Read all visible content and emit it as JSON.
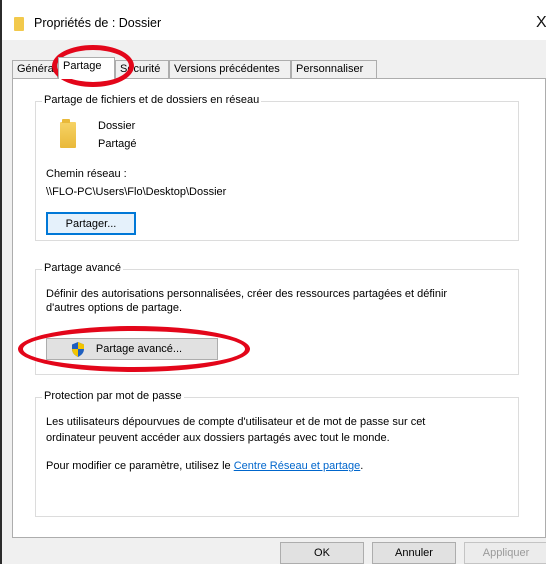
{
  "window": {
    "title": "Propriétés de : Dossier",
    "close_symbol": "X"
  },
  "tabs": [
    {
      "label": "Général",
      "active": false
    },
    {
      "label": "Partage",
      "active": true
    },
    {
      "label": "Sécurité",
      "active": false
    },
    {
      "label": "Versions précédentes",
      "active": false
    },
    {
      "label": "Personnaliser",
      "active": false
    }
  ],
  "network_sharing": {
    "group_title": "Partage de fichiers et de dossiers en réseau",
    "folder_name": "Dossier",
    "folder_status": "Partagé",
    "path_label": "Chemin réseau :",
    "path_value": "\\\\FLO-PC\\Users\\Flo\\Desktop\\Dossier",
    "share_button": "Partager..."
  },
  "advanced_sharing": {
    "group_title": "Partage avancé",
    "description_line1": "Définir des autorisations personnalisées, créer des ressources partagées et définir",
    "description_line2": "d'autres options de partage.",
    "button_label": "Partage avancé..."
  },
  "password_protection": {
    "group_title": "Protection par mot de passe",
    "description_line1": "Les utilisateurs dépourvues de compte d'utilisateur et de mot de passe sur cet",
    "description_line2": "ordinateur peuvent accéder aux dossiers partagés avec tout le monde.",
    "modify_text": "Pour modifier ce paramètre, utilisez le",
    "link_text": "Centre Réseau et partage",
    "after_link": "."
  },
  "footer": {
    "ok": "OK",
    "cancel": "Annuler",
    "apply": "Appliquer"
  },
  "colors": {
    "highlight_ellipse": "#e3061a",
    "link": "#0066cc",
    "focus_border": "#0078d7"
  }
}
